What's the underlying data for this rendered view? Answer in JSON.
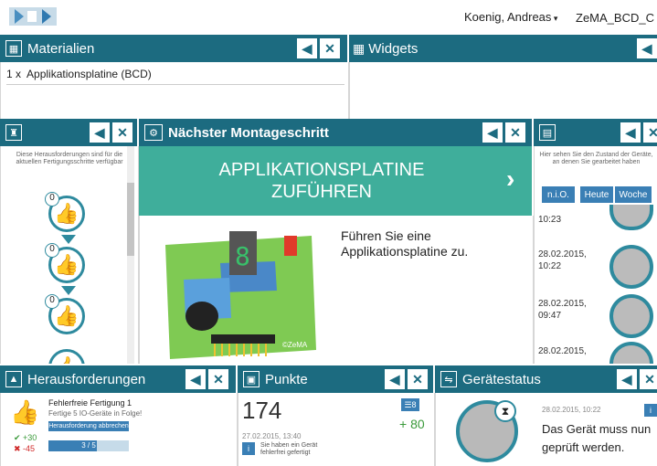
{
  "topbar": {
    "user": "Koenig, Andreas",
    "station": "ZeMA_BCD_C"
  },
  "materialien": {
    "title": "Materialien",
    "items": [
      {
        "qty": "1 x",
        "name": "Applikationsplatine (BCD)"
      }
    ]
  },
  "widgets": {
    "title": "Widgets"
  },
  "left_panel": {
    "description": "Diese Herausforderungen sind für die aktuellen Fertigungsschritte verfügbar",
    "thumb_counts": [
      "0",
      "0",
      "0"
    ]
  },
  "montage": {
    "title": "Nächster Montageschritt",
    "step_title_line1": "APPLIKATIONSPLATINE",
    "step_title_line2": "ZUFÜHREN",
    "instruction": "Führen Sie eine Applikationsplatine zu.",
    "board_label": "©ZeMA",
    "seg_digit": "8"
  },
  "right_panel": {
    "description": "Hier sehen Sie den Zustand der Geräte, an denen Sie gearbeitet haben",
    "buttons": [
      "n.i.O.",
      "Heute",
      "Woche"
    ],
    "entries": [
      {
        "date": "",
        "time": "10:23"
      },
      {
        "date": "28.02.2015,",
        "time": "10:22"
      },
      {
        "date": "28.02.2015,",
        "time": "09:47"
      },
      {
        "date": "28.02.2015,",
        "time": ""
      }
    ]
  },
  "herausforderungen": {
    "title": "Herausforderungen",
    "item_title": "Fehlerfreie Fertigung 1",
    "item_desc": "Fertige 5 IO-Geräte in Folge!",
    "cancel": "Herausforderung abbrechen",
    "plus": "+30",
    "minus": "-45",
    "progress_text": "3 / 5",
    "progress": 0.6
  },
  "punkte": {
    "title": "Punkte",
    "score": "174",
    "badge": "8",
    "delta": "+ 80",
    "timestamp": "27.02.2015, 13:40",
    "message": "Sie haben ein Gerät fehlerfrei gefertigt"
  },
  "geraetestatus": {
    "title": "Gerätestatus",
    "timestamp": "28.02.2015, 10:22",
    "message_line1": "Das Gerät muss nun",
    "message_line2": "geprüft werden."
  },
  "colors": {
    "header": "#1c6b80",
    "accent_green": "#3fae9b",
    "button_blue": "#3a7fb5"
  }
}
